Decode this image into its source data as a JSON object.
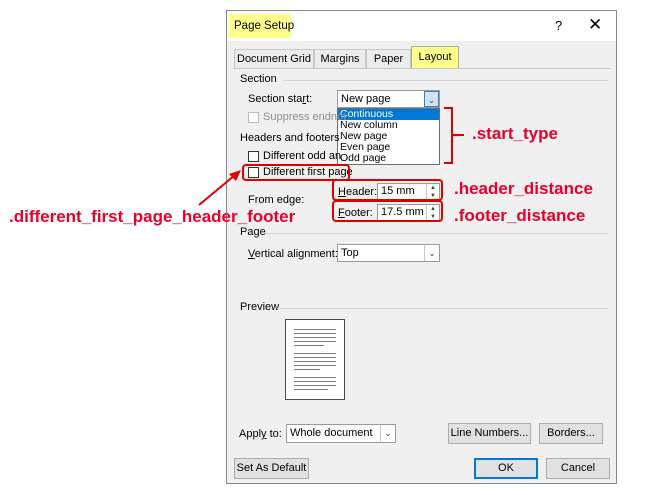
{
  "window": {
    "title": "Page Setup",
    "help": "?",
    "close": "✕"
  },
  "tabs": [
    {
      "label": "Document Grid",
      "active": false
    },
    {
      "label": "Margins",
      "active": false
    },
    {
      "label": "Paper",
      "active": false
    },
    {
      "label": "Layout",
      "active": true
    }
  ],
  "section": {
    "heading": "Section",
    "start_label": "Section start:",
    "start_value": "New page",
    "start_options": [
      "Continuous",
      "New column",
      "New page",
      "Even page",
      "Odd page"
    ],
    "start_highlighted": "Continuous",
    "suppress_label": "Suppress endnot"
  },
  "headers_footers": {
    "heading": "Headers and footers",
    "different_odd_label": "Different odd an",
    "different_first_label": "Different first page",
    "from_edge_label": "From edge:",
    "header_label": "Header:",
    "header_value": "15 mm",
    "footer_label": "Footer:",
    "footer_value": "17.5 mm"
  },
  "page": {
    "heading": "Page",
    "valign_label": "Vertical alignment:",
    "valign_value": "Top"
  },
  "preview": {
    "heading": "Preview"
  },
  "apply_to": {
    "label": "Apply to:",
    "value": "Whole document"
  },
  "buttons": {
    "line_numbers": "Line Numbers...",
    "borders": "Borders...",
    "set_default": "Set As Default",
    "ok": "OK",
    "cancel": "Cancel"
  },
  "annotations": {
    "start_type": ".start_type",
    "header_distance": ".header_distance",
    "footer_distance": ".footer_distance",
    "different_first_page": ".different_first_page_header_footer"
  },
  "colors": {
    "annotation_red": "#e8002a",
    "highlight_yellow": "#ffff8c",
    "selection_blue": "#0078d7"
  }
}
